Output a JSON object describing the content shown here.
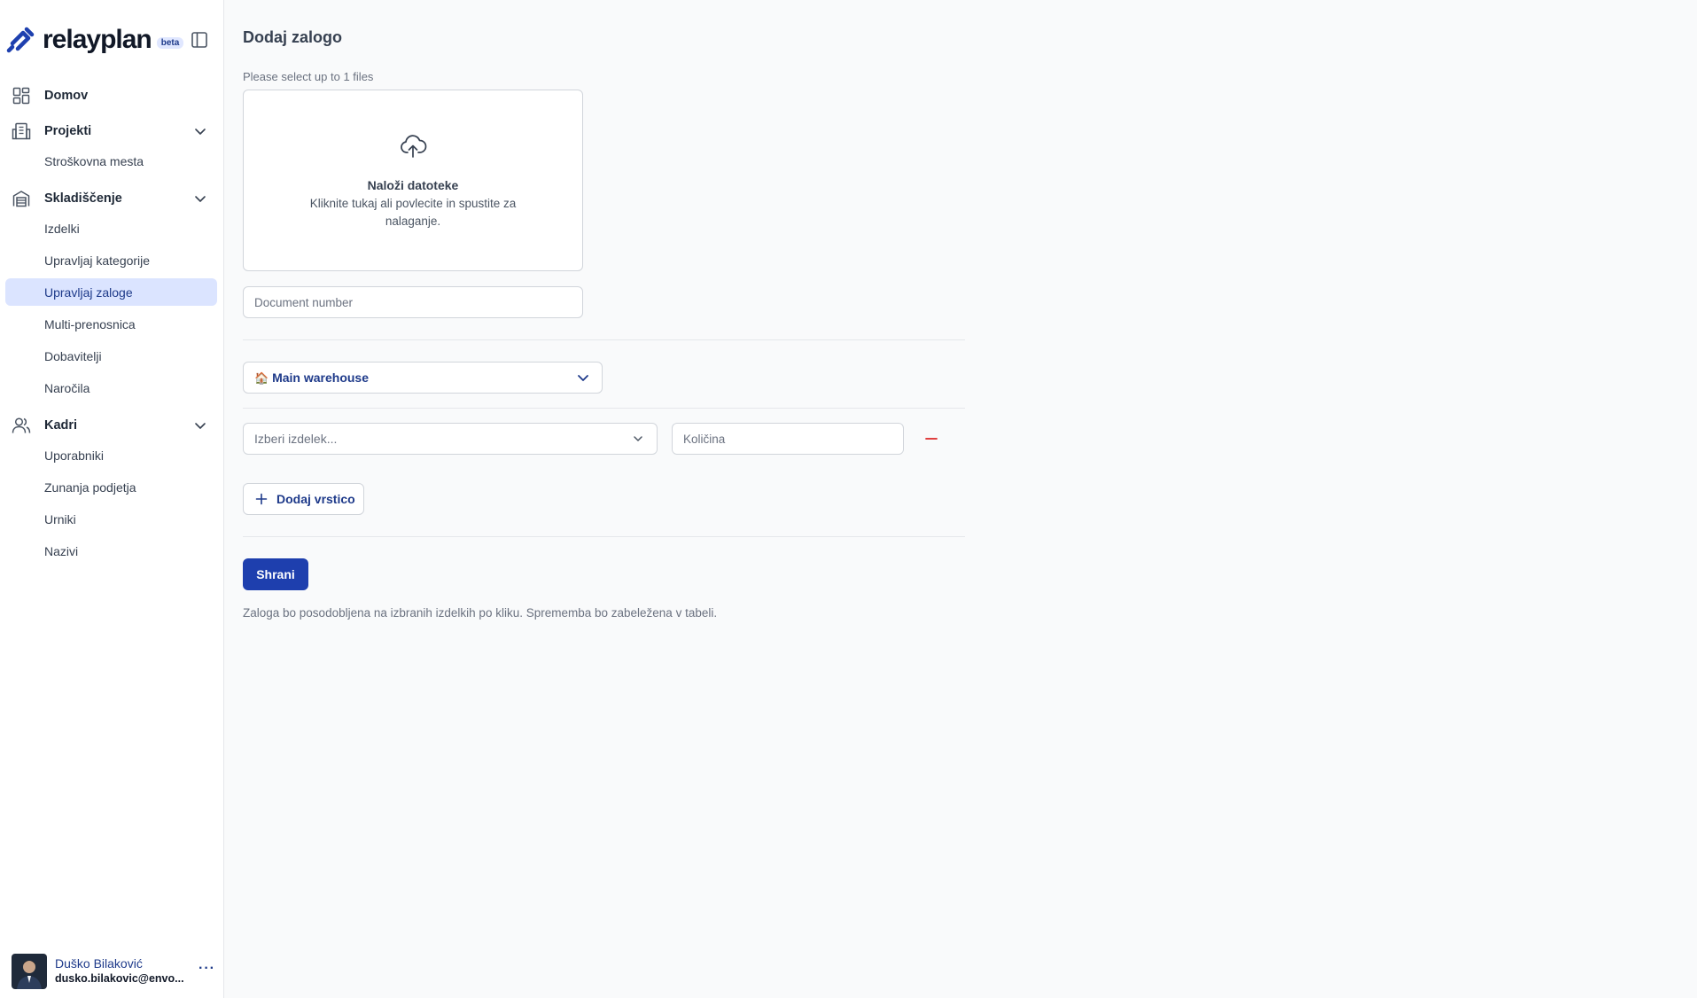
{
  "brand": {
    "name": "relayplan",
    "badge": "beta",
    "accent": "#1e40af"
  },
  "sidebar": {
    "groups": [
      {
        "label": "Domov",
        "icon": "dashboard-icon"
      },
      {
        "label": "Projekti",
        "icon": "building-icon",
        "items": [
          "Stroškovna mesta"
        ]
      },
      {
        "label": "Skladiščenje",
        "icon": "warehouse-icon",
        "items": [
          "Izdelki",
          "Upravljaj kategorije",
          "Upravljaj zaloge",
          "Multi-prenosnica",
          "Dobavitelji",
          "Naročila"
        ]
      },
      {
        "label": "Kadri",
        "icon": "users-icon",
        "items": [
          "Uporabniki",
          "Zunanja podjetja",
          "Urniki",
          "Nazivi"
        ]
      }
    ],
    "active_item": "Upravljaj zaloge"
  },
  "user": {
    "name": "Duško Bilaković",
    "email": "dusko.bilakovic@envo...",
    "more": "···"
  },
  "main": {
    "title": "Dodaj zalogo",
    "file_hint": "Please select up to 1 files",
    "dropzone": {
      "title": "Naloži datoteke",
      "description": "Kliknite tukaj ali povlecite in spustite za nalaganje."
    },
    "document_number": {
      "placeholder": "Document number",
      "value": ""
    },
    "warehouse": {
      "icon": "🏠",
      "label": "Main warehouse"
    },
    "product_select": {
      "placeholder": "Izberi izdelek..."
    },
    "quantity": {
      "placeholder": "Količina",
      "value": ""
    },
    "add_row_label": "Dodaj vrstico",
    "save_label": "Shrani",
    "note": "Zaloga bo posodobljena na izbranih izdelkih po kliku. Sprememba bo zabeležena v tabeli."
  },
  "colors": {
    "primary": "#1e3fae",
    "active_bg": "#dbe4ff",
    "remove": "#dc2626"
  }
}
